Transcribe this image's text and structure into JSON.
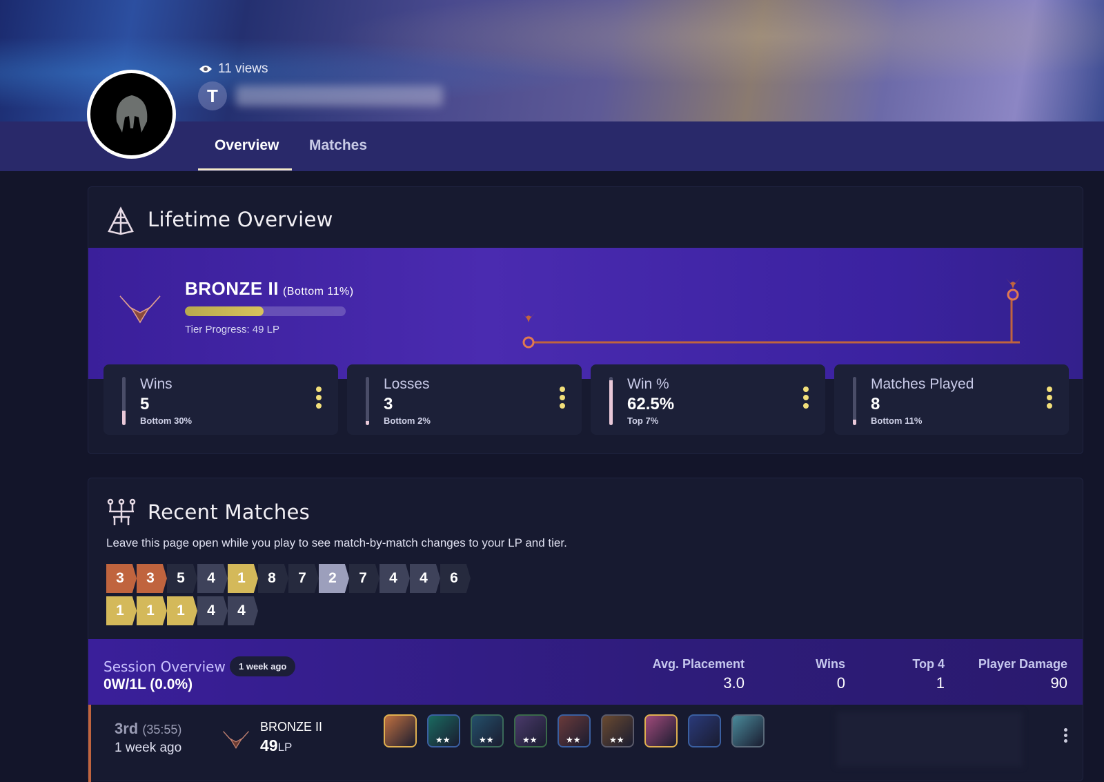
{
  "header": {
    "views": "11 views",
    "tabs": [
      {
        "label": "Overview",
        "active": true
      },
      {
        "label": "Matches",
        "active": false
      }
    ]
  },
  "lifetime": {
    "title": "Lifetime Overview",
    "rank": {
      "name": "BRONZE II",
      "percentile": "(Bottom 11%)",
      "progress_label": "Tier Progress: 49 LP",
      "progress_percent": 49
    },
    "stats": [
      {
        "label": "Wins",
        "value": "5",
        "sub": "Bottom 30%",
        "fill": 30
      },
      {
        "label": "Losses",
        "value": "3",
        "sub": "Bottom 2%",
        "fill": 2
      },
      {
        "label": "Win %",
        "value": "62.5%",
        "sub": "Top 7%",
        "fill": 93
      },
      {
        "label": "Matches Played",
        "value": "8",
        "sub": "Bottom 11%",
        "fill": 11
      }
    ]
  },
  "recent": {
    "title": "Recent Matches",
    "description": "Leave this page open while you play to see match-by-match changes to your LP and tier.",
    "placements": [
      3,
      3,
      5,
      4,
      1,
      8,
      7,
      2,
      7,
      4,
      4,
      6,
      1,
      1,
      1,
      4,
      4
    ],
    "colors": {
      "1": "#d4b95a",
      "2": "#9c9fbc",
      "3": "#c0643e",
      "4": "#3e425a",
      "other": "#262a3e"
    },
    "session": {
      "title": "Session Overview",
      "badge": "1 week ago",
      "record": "0W/1L (0.0%)",
      "columns": [
        {
          "label": "Avg. Placement",
          "value": "3.0"
        },
        {
          "label": "Wins",
          "value": "0"
        },
        {
          "label": "Top 4",
          "value": "1"
        },
        {
          "label": "Player Damage",
          "value": "90"
        }
      ]
    },
    "match": {
      "place": "3rd",
      "duration": "(35:55)",
      "when": "1 week ago",
      "rank": "BRONZE II",
      "lp": "49",
      "lp_unit": "LP"
    }
  },
  "accent": "#4a2bb0"
}
